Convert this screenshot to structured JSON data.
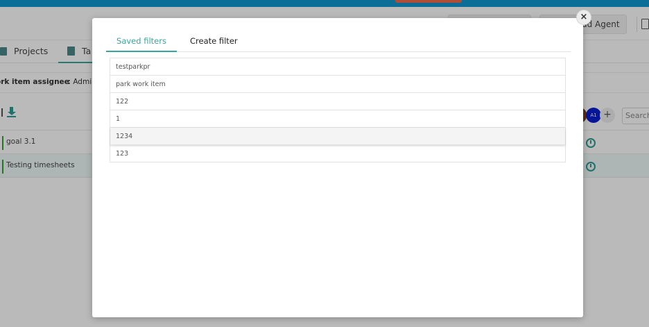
{
  "app": {
    "header": {
      "add_agent_label": "dd Agent"
    },
    "nav": {
      "projects_label": "Projects",
      "tasks_label": "Ta"
    },
    "filter_chip": {
      "key": "ork item assignee",
      "separator": " : ",
      "value": "Admin"
    },
    "avatar_initials": "A1",
    "add_symbol": "+",
    "search_placeholder": "Search",
    "rows": [
      {
        "title": "goal 3.1"
      },
      {
        "title": "Testing timesheets"
      }
    ]
  },
  "modal": {
    "close_symbol": "×",
    "tabs": [
      {
        "label": "Saved filters",
        "active": true
      },
      {
        "label": "Create filter",
        "active": false
      }
    ],
    "saved_filters": [
      "testparkpr",
      "park work item",
      "122",
      "1",
      "1234",
      "123"
    ],
    "highlighted_index": 4
  },
  "colors": {
    "accent": "#3aa59a",
    "topbar": "#0f97cf",
    "topbar_button": "#f06a4a",
    "avatar": "#0a1fd1"
  },
  "icons": [
    "projects-icon",
    "tasks-icon",
    "download-icon",
    "clock-icon",
    "document-icon",
    "close-icon"
  ]
}
